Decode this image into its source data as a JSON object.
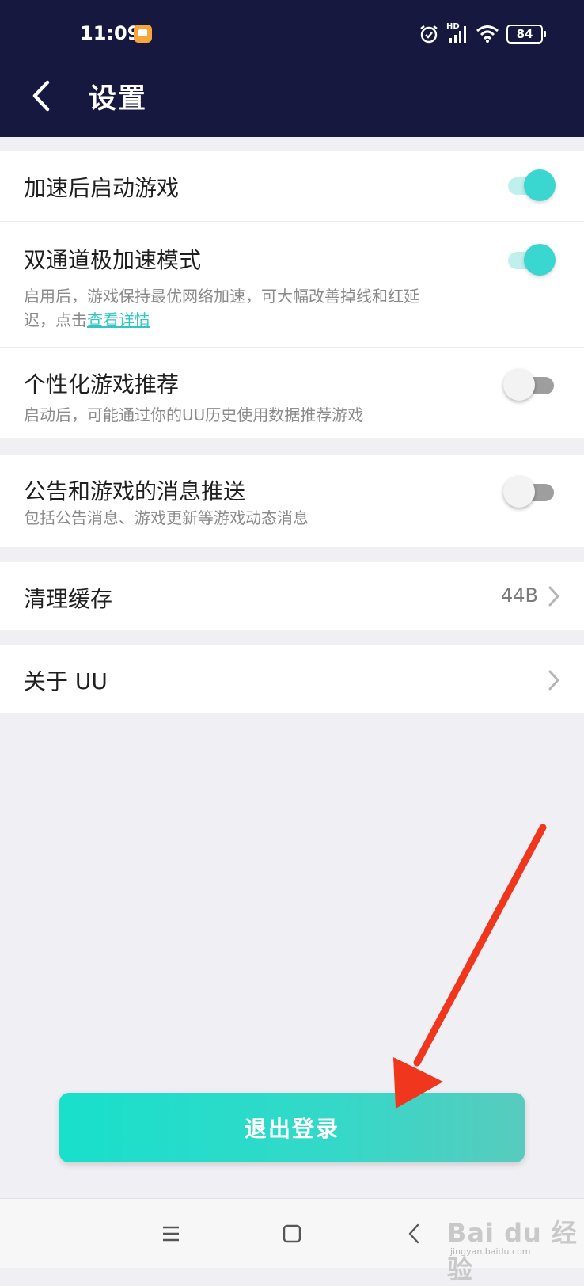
{
  "status_bar": {
    "time": "11:09",
    "network": "HD",
    "battery": "84"
  },
  "header": {
    "title": "设置"
  },
  "settings": {
    "launch_after_accel": {
      "title": "加速后启动游戏",
      "on": true
    },
    "dual_channel": {
      "title": "双通道极加速模式",
      "desc_line1": "启用后，游戏保持最优网络加速，可大幅改善掉线和红延",
      "desc_line2_prefix": "迟，点击",
      "link": "查看详情",
      "on": true
    },
    "personalized": {
      "title": "个性化游戏推荐",
      "desc": "启动后，可能通过你的UU历史使用数据推荐游戏",
      "on": false
    },
    "push": {
      "title": "公告和游戏的消息推送",
      "desc": "包括公告消息、游戏更新等游戏动态消息",
      "on": false
    },
    "cache": {
      "title": "清理缓存",
      "value": "44B"
    },
    "about": {
      "title": "关于 UU"
    }
  },
  "logout": {
    "label": "退出登录"
  },
  "watermark": {
    "brand": "Bai du 经验",
    "url": "jingyan.baidu.com"
  },
  "colors": {
    "header_bg": "#16183f",
    "accent": "#3ad6d0",
    "annotation_arrow": "#f0371e"
  }
}
